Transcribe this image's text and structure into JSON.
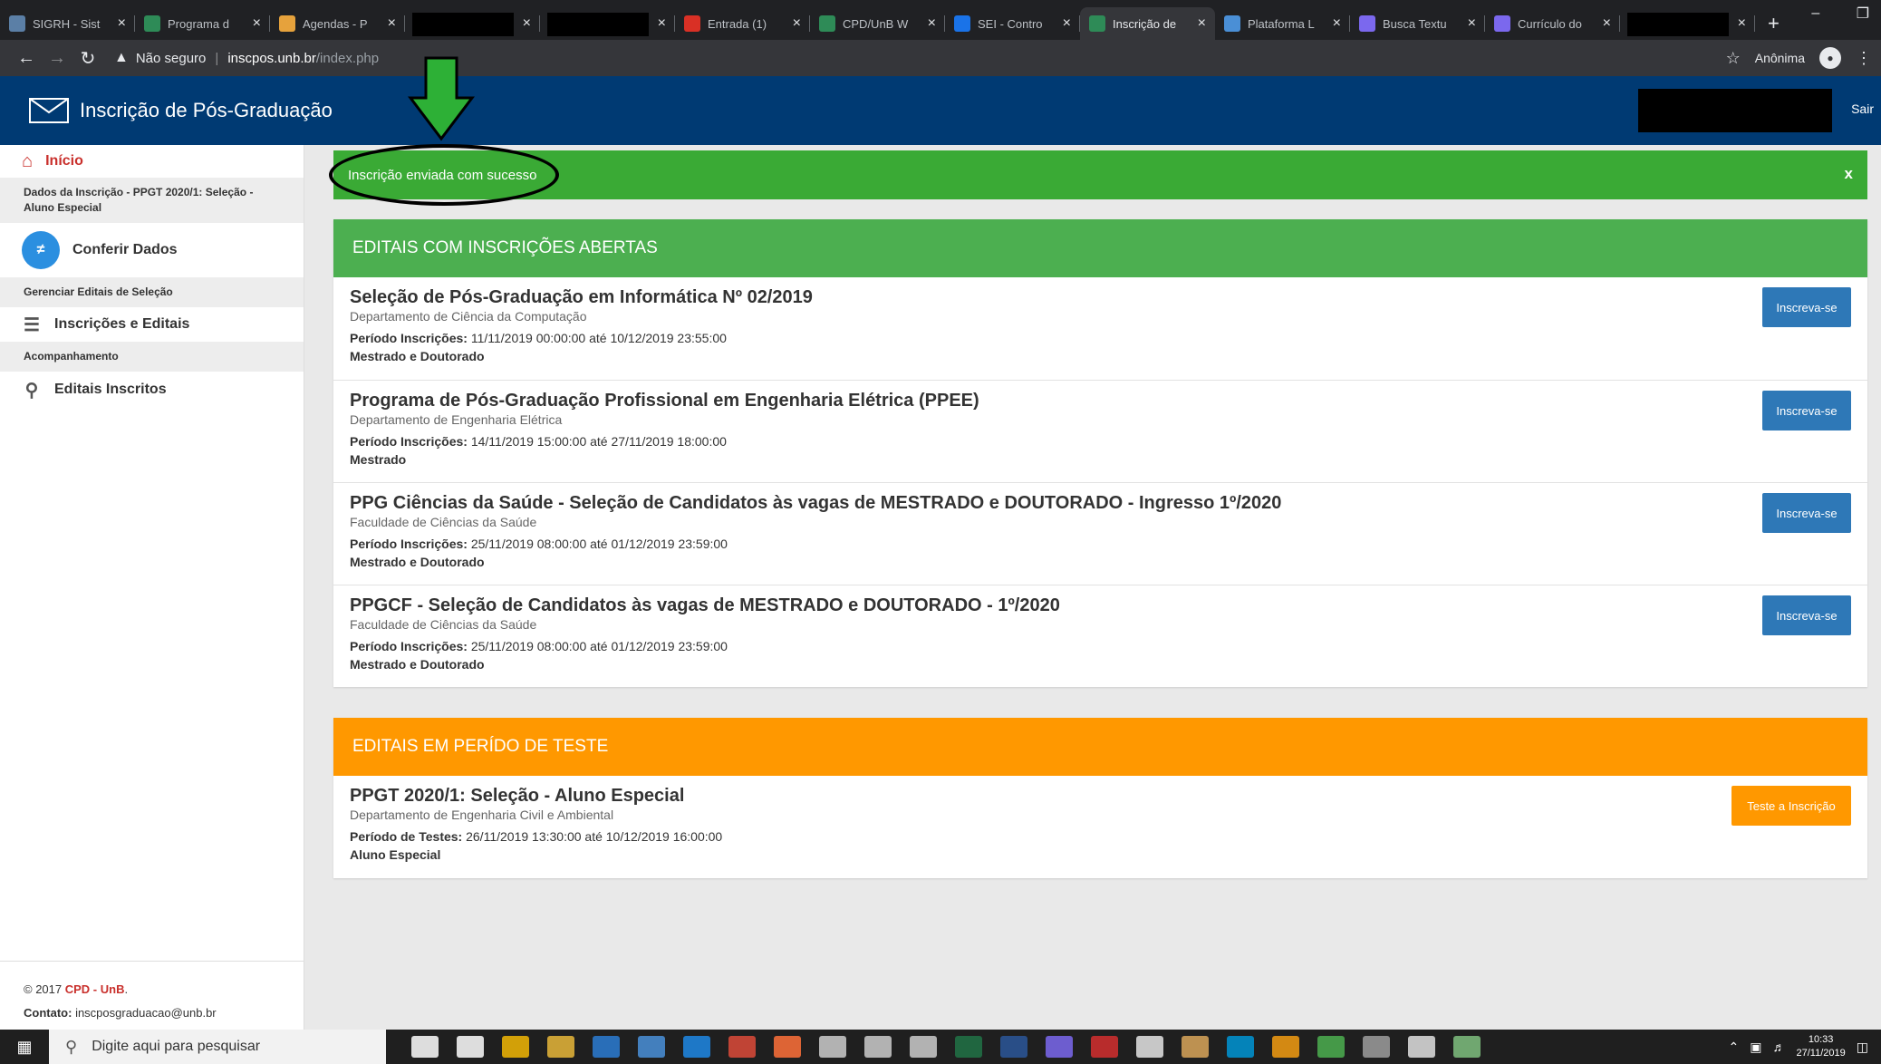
{
  "browser": {
    "tabs": [
      {
        "title": "SIGRH - Sist",
        "color": "#5b7fa6",
        "masked": false
      },
      {
        "title": "Programa d",
        "color": "#2e8b57",
        "masked": false
      },
      {
        "title": "Agendas - P",
        "color": "#e6a23c",
        "masked": false
      },
      {
        "title": "",
        "color": "#000000",
        "masked": true
      },
      {
        "title": "",
        "color": "#000000",
        "masked": true
      },
      {
        "title": "Entrada (1)",
        "color": "#d93025",
        "masked": false
      },
      {
        "title": "CPD/UnB W",
        "color": "#2e8b57",
        "masked": false
      },
      {
        "title": "SEI - Contro",
        "color": "#1a73e8",
        "masked": false
      },
      {
        "title": "Inscrição de",
        "color": "#2e8b57",
        "masked": false,
        "active": true
      },
      {
        "title": "Plataforma L",
        "color": "#4a8fd6",
        "masked": false
      },
      {
        "title": "Busca Textu",
        "color": "#7b68ee",
        "masked": false
      },
      {
        "title": "Currículo do",
        "color": "#7b68ee",
        "masked": false
      },
      {
        "title": "",
        "color": "#000000",
        "masked": true
      }
    ],
    "not_secure": "Não seguro",
    "url_host": "inscpos.unb.br",
    "url_path": "/index.php",
    "profile": "Anônima"
  },
  "app": {
    "title": "Inscrição de Pós-Graduação",
    "logout": "Sair"
  },
  "sidebar": {
    "home": "Início",
    "section_inscricao": "Dados da Inscrição - PPGT 2020/1: Seleção - Aluno Especial",
    "check": "Conferir Dados",
    "section_manage": "Gerenciar Editais de Seleção",
    "inscricoes": "Inscrições e Editais",
    "section_follow": "Acompanhamento",
    "enrolled": "Editais Inscritos",
    "footer_copy": "© 2017",
    "footer_org": "CPD - UnB",
    "footer_contact_label": "Contato:",
    "footer_contact": "inscposgraduacao@unb.br"
  },
  "alert": {
    "message": "Inscrição enviada com sucesso",
    "close": "x"
  },
  "open_panel": {
    "title": "EDITAIS COM INSCRIÇÕES ABERTAS",
    "items": [
      {
        "title": "Seleção de Pós-Graduação em Informática Nº 02/2019",
        "dept": "Departamento de Ciência da Computação",
        "period_label": "Período Inscrições:",
        "period": "11/11/2019 00:00:00 até 10/12/2019 23:55:00",
        "level": "Mestrado e Doutorado",
        "button": "Inscreva-se"
      },
      {
        "title": "Programa de Pós-Graduação Profissional em Engenharia Elétrica (PPEE)",
        "dept": "Departamento de Engenharia Elétrica",
        "period_label": "Período Inscrições:",
        "period": "14/11/2019 15:00:00 até 27/11/2019 18:00:00",
        "level": "Mestrado",
        "button": "Inscreva-se"
      },
      {
        "title": "PPG Ciências da Saúde - Seleção de Candidatos às vagas de MESTRADO e DOUTORADO - Ingresso 1º/2020",
        "dept": "Faculdade de Ciências da Saúde",
        "period_label": "Período Inscrições:",
        "period": "25/11/2019 08:00:00 até 01/12/2019 23:59:00",
        "level": "Mestrado e Doutorado",
        "button": "Inscreva-se"
      },
      {
        "title": "PPGCF - Seleção de Candidatos às vagas de MESTRADO e DOUTORADO - 1º/2020",
        "dept": "Faculdade de Ciências da Saúde",
        "period_label": "Período Inscrições:",
        "period": "25/11/2019 08:00:00 até 01/12/2019 23:59:00",
        "level": "Mestrado e Doutorado",
        "button": "Inscreva-se"
      }
    ]
  },
  "test_panel": {
    "title": "EDITAIS EM PERÍDO DE TESTE",
    "items": [
      {
        "title": "PPGT 2020/1: Seleção - Aluno Especial",
        "dept": "Departamento de Engenharia Civil e Ambiental",
        "period_label": "Período de Testes:",
        "period": "26/11/2019 13:30:00 até 10/12/2019 16:00:00",
        "level": "Aluno Especial",
        "button": "Teste a Inscrição"
      }
    ]
  },
  "taskbar": {
    "search_placeholder": "Digite aqui para pesquisar",
    "time": "10:33",
    "date": "27/11/2019",
    "app_colors": [
      "#ffffff",
      "#ffffff",
      "#f2b705",
      "#e8b73a",
      "#2b7cd3",
      "#4a90d9",
      "#1e88e5",
      "#dd4b39",
      "#ff7139",
      "#cccccc",
      "#cccccc",
      "#cccccc",
      "#217346",
      "#2b579a",
      "#7b68ee",
      "#d32f2f",
      "#e5e5e5",
      "#d9a65b",
      "#0095d5",
      "#f39c12",
      "#4caf50",
      "#9e9e9e",
      "#e0e0e0",
      "#7fbf7f"
    ]
  }
}
